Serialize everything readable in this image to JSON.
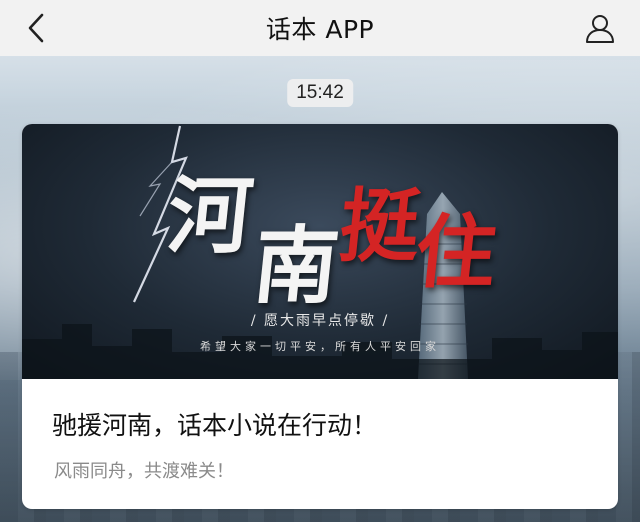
{
  "header": {
    "title": "话本 APP",
    "back_icon": "chevron-left-icon",
    "profile_icon": "user-icon"
  },
  "timestamp": "15:42",
  "article": {
    "banner": {
      "headline_chars": [
        "河",
        "南",
        "挺",
        "住"
      ],
      "slogan": "/ 愿大雨早点停歇 /",
      "subline": "希望大家一切平安，所有人平安回家",
      "accent_color": "#d42424"
    },
    "title": "驰援河南，话本小说在行动！",
    "subtitle": "风雨同舟，共渡难关！"
  }
}
